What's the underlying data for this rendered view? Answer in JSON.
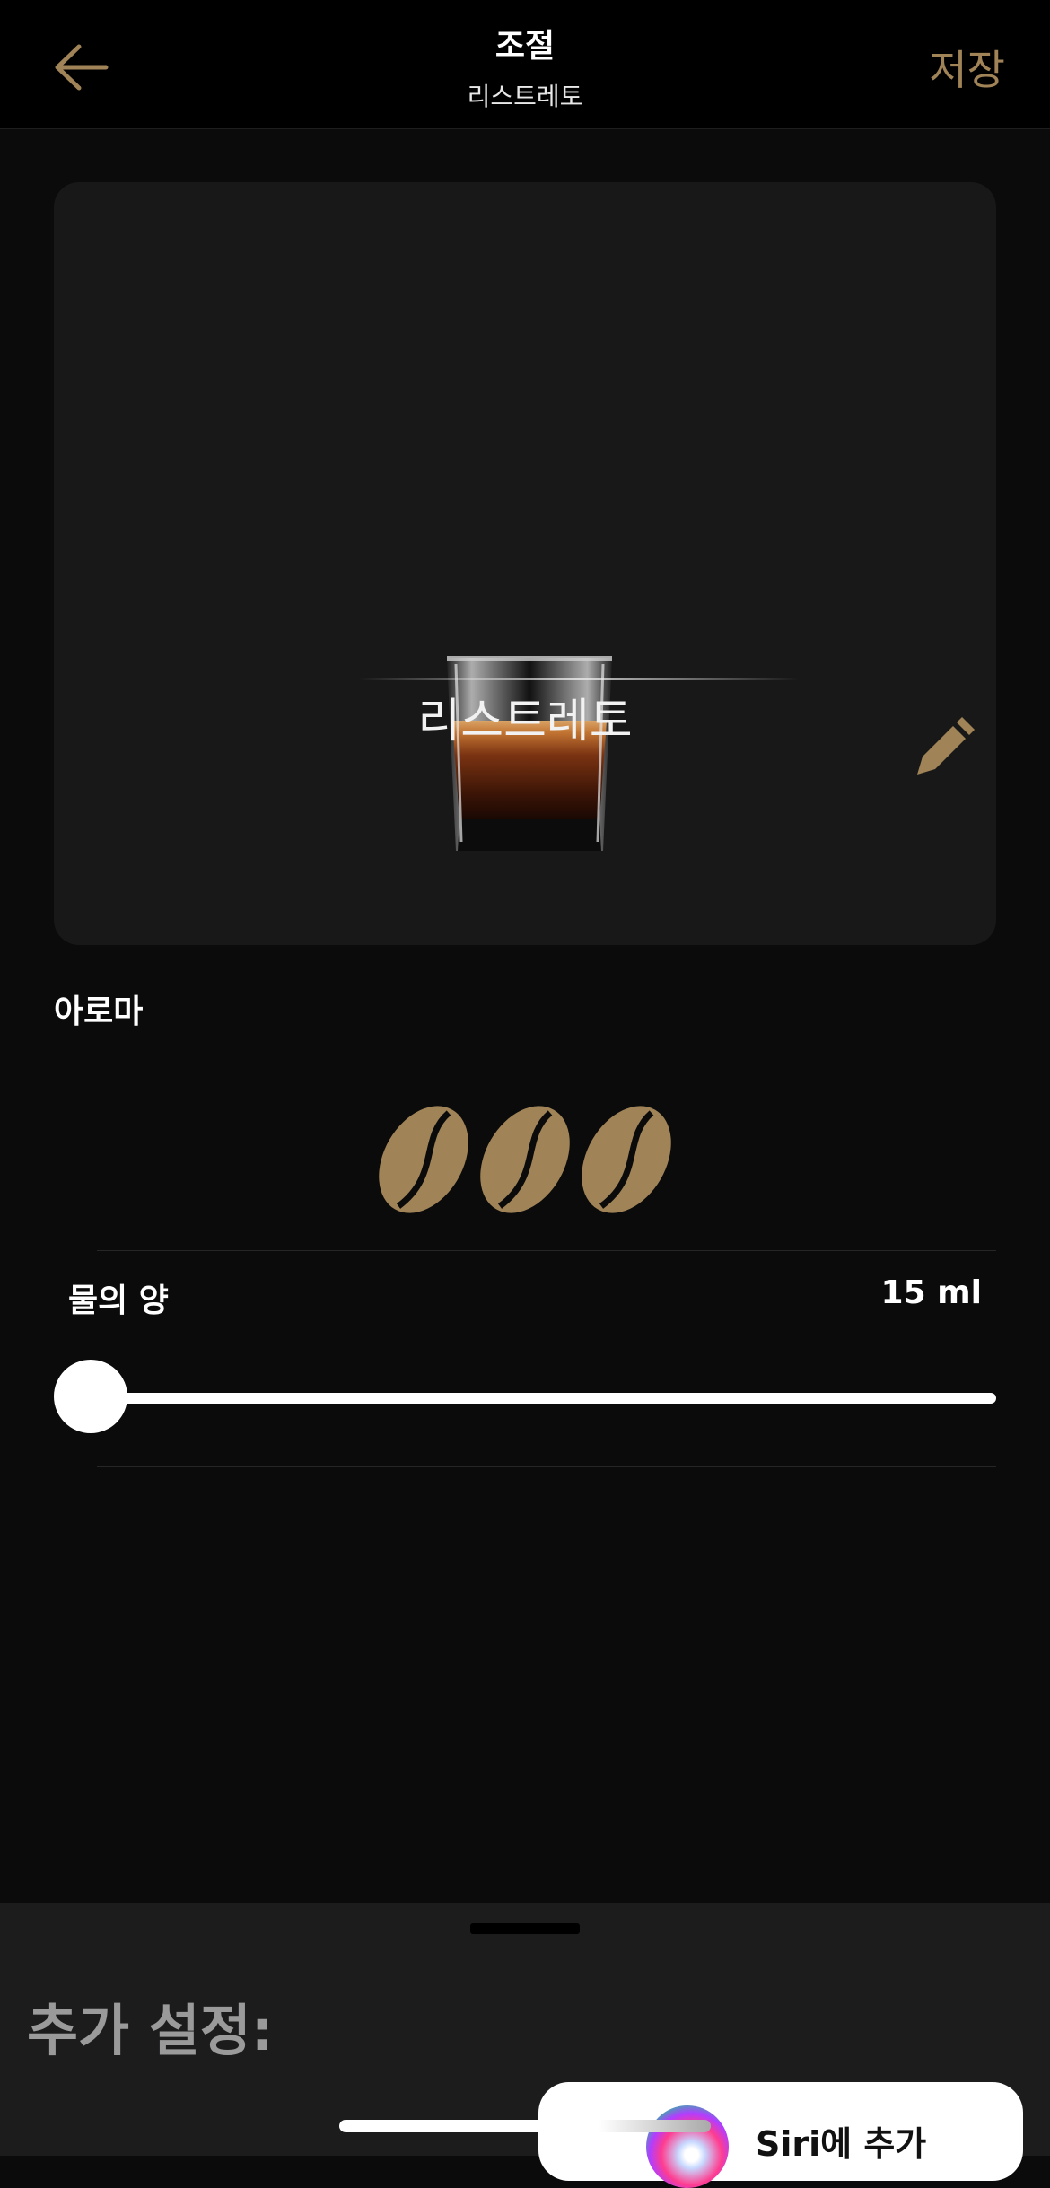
{
  "header": {
    "title": "조절",
    "subtitle": "리스트레토",
    "save_label": "저장",
    "back_icon": "arrow-left-icon"
  },
  "drink_card": {
    "name": "리스트레토",
    "image": "espresso-glass",
    "edit_icon": "pencil-icon"
  },
  "aroma": {
    "label": "아로마",
    "level": 3,
    "max": 3,
    "icon": "coffee-bean-icon"
  },
  "water": {
    "label": "물의 양",
    "value_text": "15 ml",
    "slider_fraction": 0
  },
  "sheet": {
    "title": "추가 설정:"
  },
  "siri": {
    "label": "Siri에 추가",
    "icon": "siri-icon"
  },
  "colors": {
    "accent": "#a08357",
    "background": "#0b0b0b",
    "card": "#181818",
    "sheet": "#1c1c1d"
  }
}
